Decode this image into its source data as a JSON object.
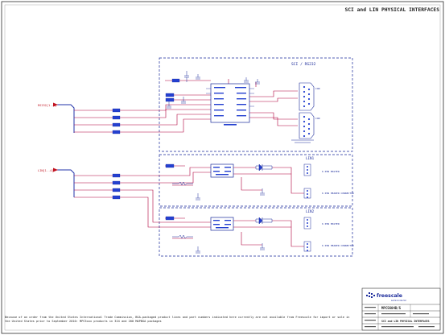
{
  "sheet": {
    "title": "SCI and LIN PHYSICAL INTERFACES",
    "frame_color": "#2b2b2b",
    "wire_color": "#b0003a",
    "bus_color": "#2233aa",
    "box_color": "#1a2a9a",
    "part_color": "#2440d0",
    "label_color": "#c1121f"
  },
  "sections": {
    "sci": {
      "title": "SCI / RS232"
    },
    "lin1": {
      "title": "LIN1"
    },
    "lin2": {
      "title": "LIN2"
    }
  },
  "left_nets": {
    "sci": "RS232[1..8]",
    "lin": "LIN[1..4]"
  },
  "connectors": {
    "sci_top": "CON",
    "sci_bottom": "CON",
    "lin1_master": "6 PIN MASTER",
    "lin1_ext": "6 PIN HEADER CONNECTOR",
    "lin2_master": "6 PIN MASTER",
    "lin2_ext": "6 PIN HEADER CONNECTOR"
  },
  "footer_note": "Because of an order from the United States International Trade Commission, BGA-packaged product lines and part numbers indicated here currently are not available from Freescale for import or sale in the United States prior to September 2010: MPC5xxx products in 324 and 208 MAPBGA packages",
  "title_block": {
    "company": "freescale",
    "company_sub": "semiconductor",
    "board": "MPC5604B/S",
    "sheet_title": "SCI and LIN PHYSICAL INTERFACES"
  }
}
